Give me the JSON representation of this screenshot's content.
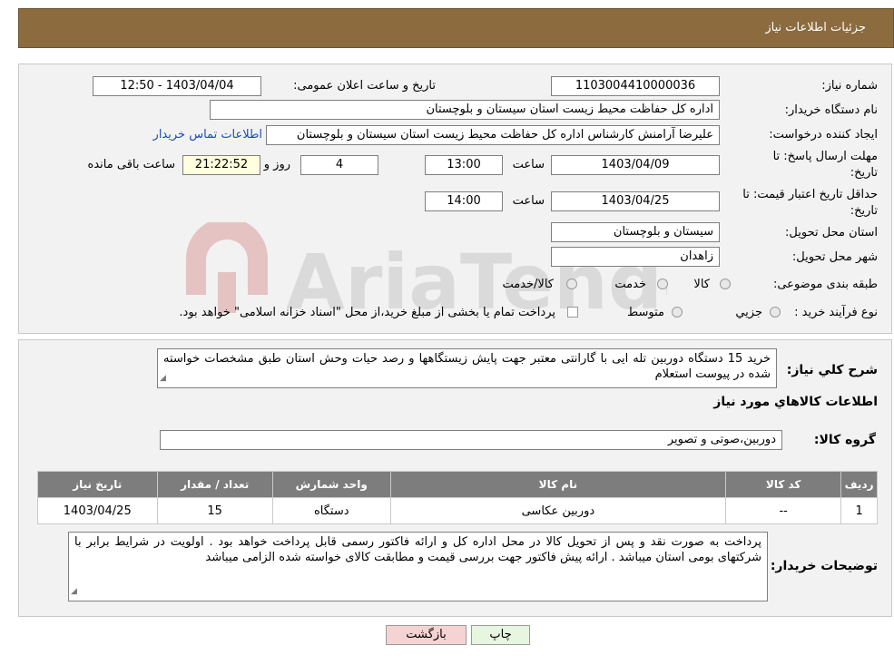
{
  "header": {
    "title": "جزئیات اطلاعات نیاز"
  },
  "info": {
    "need_number_label": "شماره نیاز:",
    "need_number": "1103004410000036",
    "announce_label": "تاریخ و ساعت اعلان عمومی:",
    "announce_value": "1403/04/04 - 12:50",
    "buyer_org_label": "نام دستگاه خریدار:",
    "buyer_org": "اداره کل حفاظت محیط زیست استان سیستان و بلوچستان",
    "requester_label": "ایجاد کننده درخواست:",
    "requester": "علیرضا آرامنش کارشناس اداره کل حفاظت محیط زیست استان سیستان و بلوچستان",
    "contact_link": "اطلاعات تماس خریدار",
    "deadline_label_1": "مهلت ارسال پاسخ: تا",
    "deadline_label_2": "تاریخ:",
    "deadline_date": "1403/04/09",
    "time_label": "ساعت",
    "deadline_time": "13:00",
    "days_value": "4",
    "days_label": "روز و",
    "remaining_time": "21:22:52",
    "remaining_label": "ساعت باقی مانده",
    "validity_label_1": "حداقل تاریخ اعتبار قیمت: تا",
    "validity_label_2": "تاریخ:",
    "validity_date": "1403/04/25",
    "validity_time_label": "ساعت",
    "validity_time": "14:00",
    "province_label": "استان محل تحویل:",
    "province": "سیستان و بلوچستان",
    "city_label": "شهر محل تحویل:",
    "city": "زاهدان",
    "category_label": "طبقه بندی موضوعی:",
    "category_options": [
      "کالا",
      "خدمت",
      "کالا/خدمت"
    ],
    "process_label": "نوع فرآیند خرید :",
    "process_options": [
      "جزیي",
      "متوسط"
    ],
    "payment_note": "پرداخت تمام یا بخشی از مبلغ خرید،از محل \"اسناد خزانه اسلامی\" خواهد بود."
  },
  "watermark": {
    "brand": "AriaTender.neT"
  },
  "description": {
    "label": "شرح کلي نیاز:",
    "text": "خرید 15 دستگاه دوربین تله ایی با گارانتی معتبر جهت پایش زیستگاهها و رصد حیات وحش استان طبق مشخصات خواسته شده در پیوست استعلام"
  },
  "goods": {
    "section_title": "اطلاعات کالاهاي مورد نیاز",
    "group_label": "گروه کالا:",
    "group_value": "دوربین،صوتی و تصویر",
    "columns": [
      "ردیف",
      "کد کالا",
      "نام کالا",
      "واحد شمارش",
      "تعداد / مقدار",
      "تاریخ نیاز"
    ],
    "rows": [
      [
        "1",
        "--",
        "دوربین عکاسی",
        "دستگاه",
        "15",
        "1403/04/25"
      ]
    ]
  },
  "buyer_notes": {
    "label": "توضیحات خریدار:",
    "text": "پرداخت به صورت نقد و پس از تحویل کالا در محل اداره کل و ارائه فاکتور رسمی قابل پرداخت خواهد بود . اولویت در شرایط برابر با شرکتهای بومی استان میباشد . ارائه پیش فاکتور جهت بررسی قیمت و مطابقت کالای خواسته شده الزامی میباشد"
  },
  "buttons": {
    "print": "چاپ",
    "back": "بازگشت"
  },
  "colors": {
    "header": "#8c6b3e",
    "back_button": "#f6d3d3",
    "print_button": "#e6f6e0",
    "link": "#1a4cc2"
  }
}
